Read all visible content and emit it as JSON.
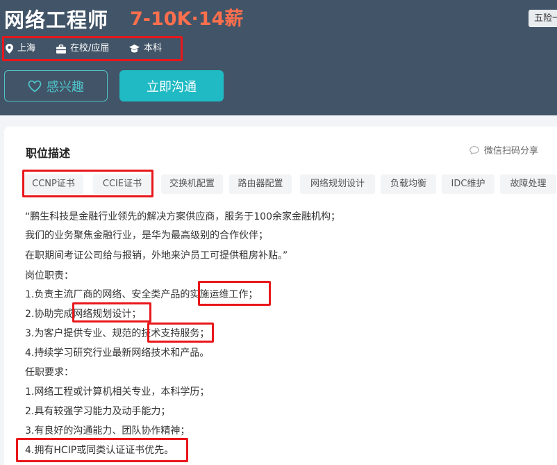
{
  "header": {
    "title": "网络工程师",
    "salary": "7-10K·14薪",
    "benefit_tag": "五险一金",
    "requirements": [
      {
        "icon": "location-pin-icon",
        "label": "上海"
      },
      {
        "icon": "briefcase-icon",
        "label": "在校/应届"
      },
      {
        "icon": "graduation-cap-icon",
        "label": "本科"
      }
    ],
    "interest_button": "感兴趣",
    "chat_button": "立即沟通"
  },
  "description": {
    "title": "职位描述",
    "share_label": "微信扫码分享",
    "tags": [
      "CCNP证书",
      "CCIE证书",
      "交换机配置",
      "路由器配置",
      "网络规划设计",
      "负载均衡",
      "IDC维护",
      "故障处理"
    ],
    "lines": [
      "“鹏生科技是金融行业领先的解决方案供应商，服务于100余家金融机构；",
      "我们的业务聚焦金融行业，是华为最高级别的合作伙伴；",
      "在职期间考证公司给与报销，外地来沪员工可提供租房补贴。”",
      "岗位职责：",
      "1.负责主流厂商的网络、安全类产品的实施运维工作；",
      "2.协助完成网络规划设计；",
      "3.为客户提供专业、规范的技术支持服务；",
      "4.持续学习研究行业最新网络技术和产品。",
      "任职要求：",
      "1.网络工程或计算机相关专业，本科学历；",
      "2.具有较强学习能力及动手能力；",
      "3.有良好的沟通能力、团队协作精神；",
      "4.拥有HCIP或同类认证证书优先。"
    ]
  },
  "colors": {
    "header_bg": "#425467",
    "salary": "#ff6f4e",
    "accent": "#1fbac4",
    "highlight_box": "#e8171b"
  }
}
